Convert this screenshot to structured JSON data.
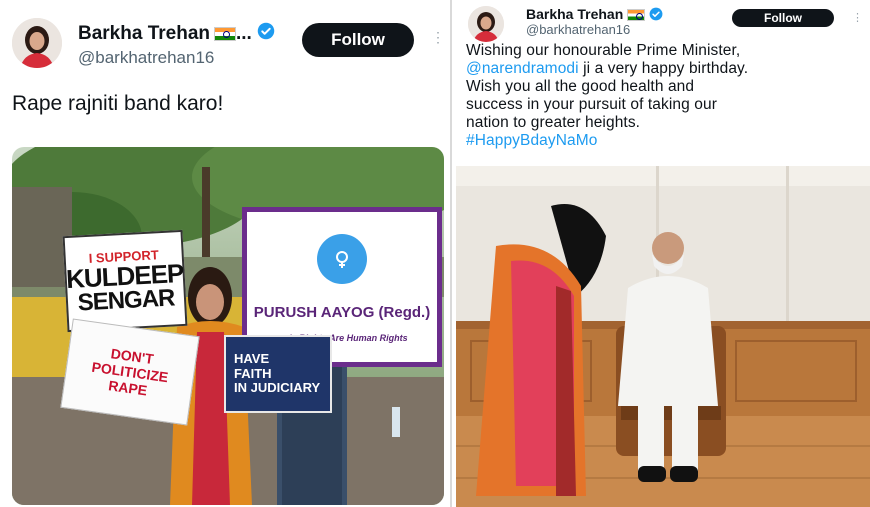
{
  "left_tweet": {
    "display_name": "Barkha Trehan",
    "name_ellipsis": "...",
    "handle": "@barkhatrehan16",
    "follow_label": "Follow",
    "text": "Rape rajniti band karo!",
    "placards": {
      "support_line1": "I SUPPORT",
      "support_line2": "KULDEEP",
      "support_line3": "SENGAR",
      "politicize_line1": "DON'T",
      "politicize_line2": "POLITICIZE",
      "politicize_line3": "RAPE",
      "aayog_title": "PURUSH AAYOG (Regd.)",
      "aayog_sub": "...n's Rights Are Human Rights",
      "faith_line1": "HAVE",
      "faith_line2": "FAITH",
      "faith_line3": "IN JUDICIARY"
    }
  },
  "right_tweet": {
    "display_name": "Barkha Trehan",
    "handle": "@barkhatrehan16",
    "follow_label": "Follow",
    "text_line1": "Wishing our honourable Prime Minister,",
    "mention": "@narendramodi",
    "text_line2_rest": " ji a very happy birthday.",
    "text_line3": "Wish you all the good health and",
    "text_line4": "success in your pursuit of taking our",
    "text_line5": "nation to greater heights.",
    "hashtag": "#HappyBdayNaMo"
  },
  "colors": {
    "text_primary": "#0f1419",
    "text_secondary": "#536471",
    "link": "#1d9bf0",
    "verified": "#1d9bf0",
    "follow_bg": "#0f1419"
  }
}
